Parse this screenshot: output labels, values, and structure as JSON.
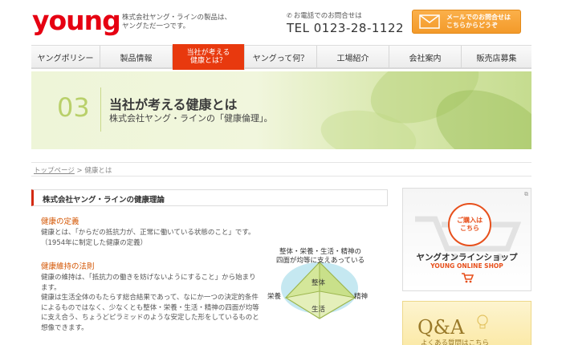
{
  "header": {
    "logo": "young",
    "tagline_line1": "株式会社ヤング・ラインの製品は、",
    "tagline_line2": "ヤングただ一つです。",
    "phone_label": "お電話でのお問合せは",
    "phone_number": "TEL 0123-28-1122",
    "mail_line1": "メールでのお問合せは",
    "mail_line2": "こちらからどうぞ"
  },
  "nav": {
    "items": [
      {
        "label": "ヤングポリシー"
      },
      {
        "label": "製品情報"
      },
      {
        "label_line1": "当社が考える",
        "label_line2": "健康とは？"
      },
      {
        "label": "ヤングって何？"
      },
      {
        "label": "工場紹介"
      },
      {
        "label": "会社案内"
      },
      {
        "label": "販売店募集"
      }
    ]
  },
  "hero": {
    "number": "03",
    "title": "当社が考える健康とは",
    "subtitle": "株式会社ヤング・ラインの「健康倫理」。"
  },
  "breadcrumb": {
    "home": "トップページ",
    "separator": " > ",
    "current": "健康とは"
  },
  "main": {
    "section_title": "株式会社ヤング・ラインの健康理論",
    "def_title": "健康の定義",
    "def_line1": "健康とは、「からだの抵抗力が、正常に働いている状態のこと」です。",
    "def_line2": "（1954年に制定した健康の定義）",
    "law_title": "健康維持の法則",
    "law_line1": "健康の維持は、「抵抗力の働きを妨げないようにすること」から始まり",
    "law_line2": "ます。",
    "law_line3": "健康は生活全体のもたらす総合結果であって、なにか一つの決定的条件",
    "law_line4": "によるものではなく、少なくとも整体・栄養・生活・精神の四面が均等",
    "law_line5": "に支え合う、ちょうどピラミッドのような安定した形をしているものと",
    "law_line6": "想像できます。"
  },
  "diagram": {
    "caption_line1": "整体・栄養・生活・精神の",
    "caption_line2": "四面が均等に支えあっている",
    "top": "整体",
    "left": "栄養",
    "right": "精神",
    "bottom": "生活"
  },
  "sidebar": {
    "shop_circle_line1": "ご購入は",
    "shop_circle_line2": "こちら",
    "shop_jp": "ヤングオンラインショップ",
    "shop_en": "YOUNG ONLINE SHOP",
    "qa_title": "Q&A",
    "qa_sub": "よくある質問はこちら"
  },
  "colors": {
    "brand_red": "#e60012",
    "nav_active": "#e8390e",
    "accent_orange": "#d35400",
    "mail_orange": "#f39a2a",
    "hero_green": "#b9d06a"
  }
}
